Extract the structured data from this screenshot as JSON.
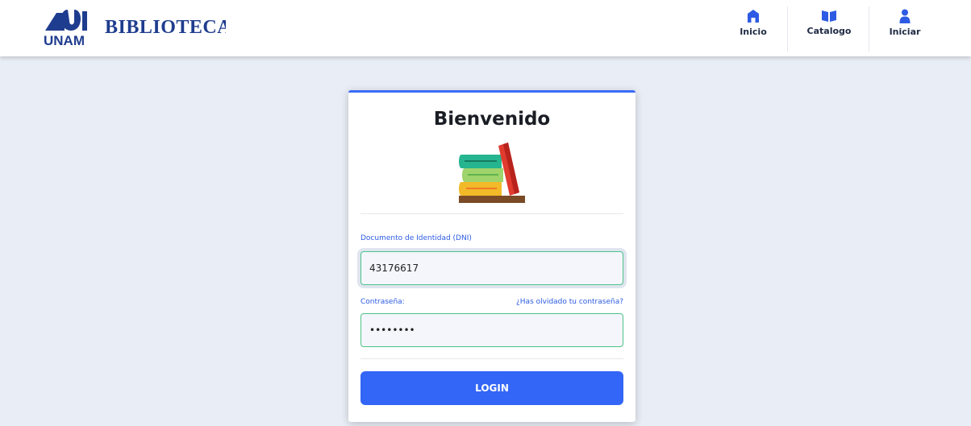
{
  "header": {
    "logo_text": "UNAM",
    "site_title": "BIBLIOTECA",
    "nav": [
      {
        "label": "Inicio",
        "icon": "home-icon"
      },
      {
        "label": "Catalogo",
        "icon": "book-open-icon"
      },
      {
        "label": "Iniciar",
        "icon": "user-icon"
      }
    ],
    "colors": {
      "brand": "#1f3d8f",
      "nav_icon": "#2d5be3"
    }
  },
  "login": {
    "title": "Bienvenido",
    "image_icon": "books-icon",
    "dni_label": "Documento de Identidad (DNI)",
    "dni_value": "43176617",
    "password_label": "Contraseña:",
    "forgot_link": "¿Has olvidado tu contraseña?",
    "password_value": "••••••••",
    "login_button": "LOGIN",
    "colors": {
      "accent": "#3366f6",
      "input_border": "#4cc38a"
    }
  }
}
